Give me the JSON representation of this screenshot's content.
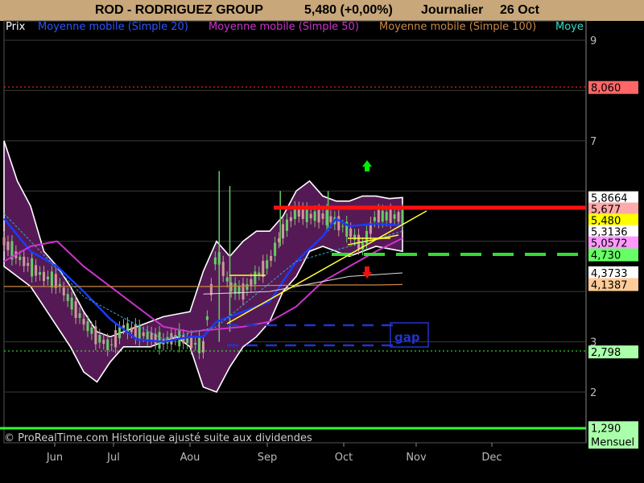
{
  "header": {
    "symbol": "ROD - RODRIGUEZ GROUP",
    "quote": "5,480 (+0,00%)",
    "period": "Journalier",
    "date": "26 Oct"
  },
  "legend": {
    "price": "Prix",
    "ma20": "Moyenne mobile (Simple 20)",
    "ma50": "Moyenne mobile (Simple 50)",
    "ma100": "Moyenne mobile (Simple 100)",
    "ma_more": "Moye"
  },
  "footer": {
    "copyright": "© ProRealTime.com Historique ajusté suite aux dividendes"
  },
  "annotations": {
    "gap_label": "gap"
  },
  "colors": {
    "header_bg": "#c8a77a",
    "price_up": "#66cc66",
    "price_down": "#cc9999",
    "bollinger_fill": "#551a55",
    "bollinger_edge": "#ffffff",
    "ma20": "#1a3aff",
    "ma50": "#cc33cc",
    "ma100": "#cc8844",
    "resistance": "#ff0000",
    "support": "#33dd33",
    "trendline": "#ffff33",
    "gap_box": "#2233aa"
  },
  "chart_data": {
    "type": "line",
    "title": "ROD - RODRIGUEZ GROUP",
    "x_ticks": [
      "Jun",
      "Jul",
      "Aou",
      "Sep",
      "Oct",
      "Nov",
      "Dec"
    ],
    "y_ticks": [
      2,
      3,
      4,
      5,
      6,
      7,
      8,
      9
    ],
    "y_tick_labels_visible": [
      "2",
      "3",
      "7",
      "9"
    ],
    "ylim": [
      1.55,
      9.15
    ],
    "grid": true,
    "price_labels": [
      {
        "value": 8.06,
        "text": "8,060",
        "bg": "#ff6666"
      },
      {
        "value": 5.8664,
        "text": "5,8664",
        "bg": "#ffffff"
      },
      {
        "value": 5.677,
        "text": "5,677",
        "bg": "#ffaaaa"
      },
      {
        "value": 5.48,
        "text": "5,480",
        "bg": "#ffff00"
      },
      {
        "value": 5.3136,
        "text": "5,3136",
        "bg": "#ffffff"
      },
      {
        "value": 5.0572,
        "text": "5,0572",
        "bg": "#ff99ff"
      },
      {
        "value": 4.73,
        "text": "4,730",
        "bg": "#66ff66"
      },
      {
        "value": 4.3733,
        "text": "4,3733",
        "bg": "#ffffff"
      },
      {
        "value": 4.1387,
        "text": "4,1387",
        "bg": "#ffcc99"
      },
      {
        "value": 2.798,
        "text": "2,798",
        "bg": "#aaffaa"
      },
      {
        "value": 1.29,
        "text": "1,290",
        "bg": "#aaffaa",
        "sub": "Mensuel"
      }
    ],
    "series": [
      {
        "name": "Prix",
        "x": [
          0,
          5,
          10,
          15,
          20,
          25,
          30,
          35,
          40,
          45,
          50,
          55,
          60,
          65,
          70,
          75,
          80,
          85,
          90,
          95,
          100,
          105,
          110,
          115,
          120,
          125,
          130,
          135,
          140,
          145,
          150
        ],
        "values": [
          5.0,
          4.7,
          4.5,
          4.3,
          4.2,
          3.8,
          3.4,
          3.1,
          2.9,
          3.3,
          3.2,
          3.1,
          3.0,
          3.1,
          3.0,
          2.9,
          4.8,
          4.1,
          4.0,
          4.3,
          4.6,
          5.2,
          5.6,
          5.5,
          5.5,
          5.4,
          5.2,
          4.9,
          5.5,
          5.5,
          5.48
        ]
      },
      {
        "name": "Moyenne mobile (Simple 20)",
        "x": [
          0,
          10,
          20,
          30,
          40,
          50,
          60,
          70,
          75,
          80,
          90,
          100,
          110,
          120,
          125,
          130,
          140,
          150
        ],
        "values": [
          5.45,
          4.8,
          4.5,
          4.0,
          3.45,
          3.05,
          3.0,
          3.1,
          3.1,
          3.4,
          3.6,
          3.8,
          4.6,
          5.1,
          5.45,
          5.3,
          5.35,
          5.31
        ]
      },
      {
        "name": "Moyenne mobile (Simple 50)",
        "x": [
          0,
          10,
          20,
          30,
          40,
          50,
          60,
          70,
          80,
          90,
          100,
          110,
          120,
          130,
          140,
          150
        ],
        "values": [
          4.6,
          4.9,
          5.0,
          4.5,
          4.1,
          3.7,
          3.3,
          3.2,
          3.25,
          3.3,
          3.4,
          3.7,
          4.2,
          4.5,
          4.8,
          5.06
        ]
      },
      {
        "name": "Moyenne mobile (Simple 100)",
        "x": [
          0,
          20,
          40,
          60,
          80,
          100,
          120,
          140,
          150
        ],
        "values": [
          4.1,
          4.1,
          4.1,
          4.1,
          4.1,
          4.12,
          4.13,
          4.13,
          4.14
        ]
      }
    ],
    "bollinger": {
      "x": [
        0,
        5,
        10,
        15,
        20,
        25,
        30,
        35,
        40,
        45,
        50,
        55,
        60,
        65,
        70,
        75,
        80,
        85,
        90,
        95,
        100,
        105,
        110,
        115,
        120,
        125,
        130,
        135,
        140,
        145,
        150
      ],
      "upper": [
        7.0,
        6.2,
        5.7,
        4.8,
        4.5,
        4.1,
        3.6,
        3.2,
        3.1,
        3.2,
        3.3,
        3.4,
        3.5,
        3.55,
        3.6,
        4.4,
        5.0,
        4.7,
        5.0,
        5.2,
        5.2,
        5.5,
        6.0,
        6.2,
        5.9,
        5.8,
        5.8,
        5.9,
        5.9,
        5.85,
        5.87
      ],
      "lower": [
        4.5,
        4.3,
        4.1,
        3.7,
        3.3,
        2.9,
        2.4,
        2.2,
        2.6,
        2.9,
        2.9,
        2.9,
        3.0,
        3.1,
        2.9,
        2.1,
        2.0,
        2.5,
        2.9,
        3.1,
        3.4,
        4.0,
        4.3,
        4.8,
        4.9,
        4.8,
        4.7,
        4.8,
        4.9,
        4.85,
        4.8
      ]
    }
  }
}
